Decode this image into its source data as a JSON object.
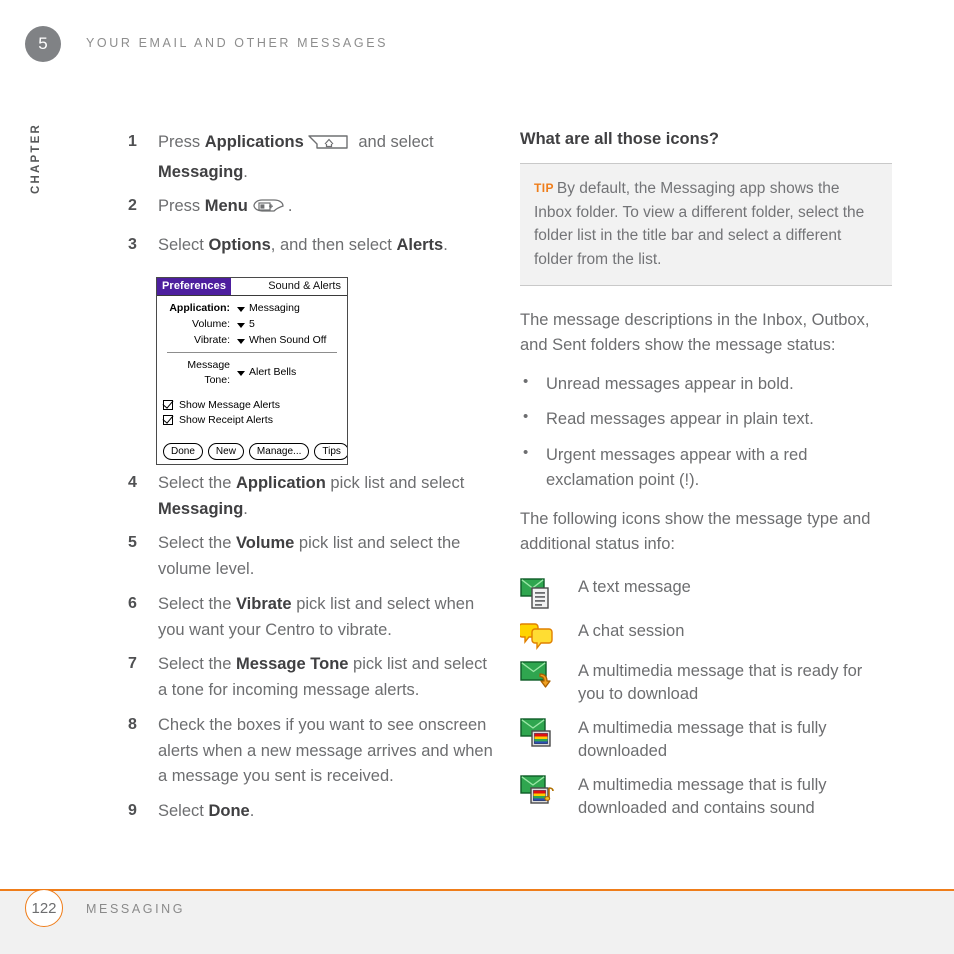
{
  "header": {
    "chapter_number": "5",
    "running_head": "YOUR EMAIL AND OTHER MESSAGES",
    "chapter_word": "CHAPTER"
  },
  "footer": {
    "page_number": "122",
    "label": "MESSAGING",
    "rule_color": "#ef7d1a"
  },
  "left_column": {
    "steps": [
      {
        "num": "1",
        "text_before": "Press ",
        "bold1": "Applications",
        "icon": "applications-key-icon",
        "text_mid": " and select ",
        "bold2": "Messaging",
        "text_after": "."
      },
      {
        "num": "2",
        "text_before": "Press ",
        "bold1": "Menu",
        "icon": "menu-key-icon",
        "text_mid": "",
        "bold2": "",
        "text_after": "."
      },
      {
        "num": "3",
        "text_before": "Select ",
        "bold1": "Options",
        "icon": "",
        "text_mid": ", and then select ",
        "bold2": "Alerts",
        "text_after": "."
      }
    ],
    "steps_after": [
      {
        "num": "4",
        "text_before": "Select the ",
        "bold1": "Application",
        "text_mid": " pick list and select ",
        "bold2": "Messaging",
        "text_after": "."
      },
      {
        "num": "5",
        "text_before": "Select the ",
        "bold1": "Volume",
        "text_mid": " pick list and select the volume level.",
        "bold2": "",
        "text_after": ""
      },
      {
        "num": "6",
        "text_before": "Select the ",
        "bold1": "Vibrate",
        "text_mid": " pick list and select when you want your Centro to vibrate.",
        "bold2": "",
        "text_after": ""
      },
      {
        "num": "7",
        "text_before": "Select the ",
        "bold1": "Message Tone",
        "text_mid": " pick list and select a tone for incoming message alerts.",
        "bold2": "",
        "text_after": ""
      },
      {
        "num": "8",
        "text_before": "Check the boxes if you want to see onscreen alerts when a new message arrives and when a message you sent is received.",
        "bold1": "",
        "text_mid": "",
        "bold2": "",
        "text_after": ""
      },
      {
        "num": "9",
        "text_before": "Select ",
        "bold1": "Done",
        "text_mid": "",
        "bold2": "",
        "text_after": "."
      }
    ],
    "screenshot": {
      "title_left": "Preferences",
      "title_right": "Sound & Alerts",
      "title_bar_color": "#4d1f9e",
      "rows": [
        {
          "label": "Application:",
          "value": "Messaging",
          "bold": true
        },
        {
          "label": "Volume:",
          "value": "5",
          "bold": false
        },
        {
          "label": "Vibrate:",
          "value": "When Sound Off",
          "bold": false
        }
      ],
      "rows2": [
        {
          "label": "Message Tone:",
          "value": "Alert Bells",
          "bold": false
        }
      ],
      "checkboxes": [
        {
          "label": "Show Message Alerts",
          "checked": true
        },
        {
          "label": "Show Receipt Alerts",
          "checked": true
        }
      ],
      "buttons": [
        "Done",
        "New",
        "Manage...",
        "Tips"
      ]
    }
  },
  "right_column": {
    "heading": "What are all those icons?",
    "tip": {
      "label": "TIP",
      "label_color": "#ef7d1a",
      "text": "By default, the Messaging app shows the Inbox folder. To view a different folder, select the folder list in the title bar and select a different folder from the list."
    },
    "intro_paragraph": "The message descriptions in the Inbox, Outbox, and Sent folders show the message status:",
    "bullets": [
      "Unread messages appear in bold.",
      "Read messages appear in plain text.",
      "Urgent messages appear with a red exclamation point (!)."
    ],
    "second_paragraph": "The following icons show the message type and additional status info:",
    "icon_legend": [
      {
        "icon": "text-message-icon",
        "text": "A text message"
      },
      {
        "icon": "chat-session-icon",
        "text": "A chat session"
      },
      {
        "icon": "mms-ready-to-download-icon",
        "text": "A multimedia message that is ready for you to download"
      },
      {
        "icon": "mms-downloaded-icon",
        "text": "A multimedia message that is fully downloaded"
      },
      {
        "icon": "mms-downloaded-sound-icon",
        "text": "A multimedia message that is fully downloaded and contains sound"
      }
    ]
  }
}
